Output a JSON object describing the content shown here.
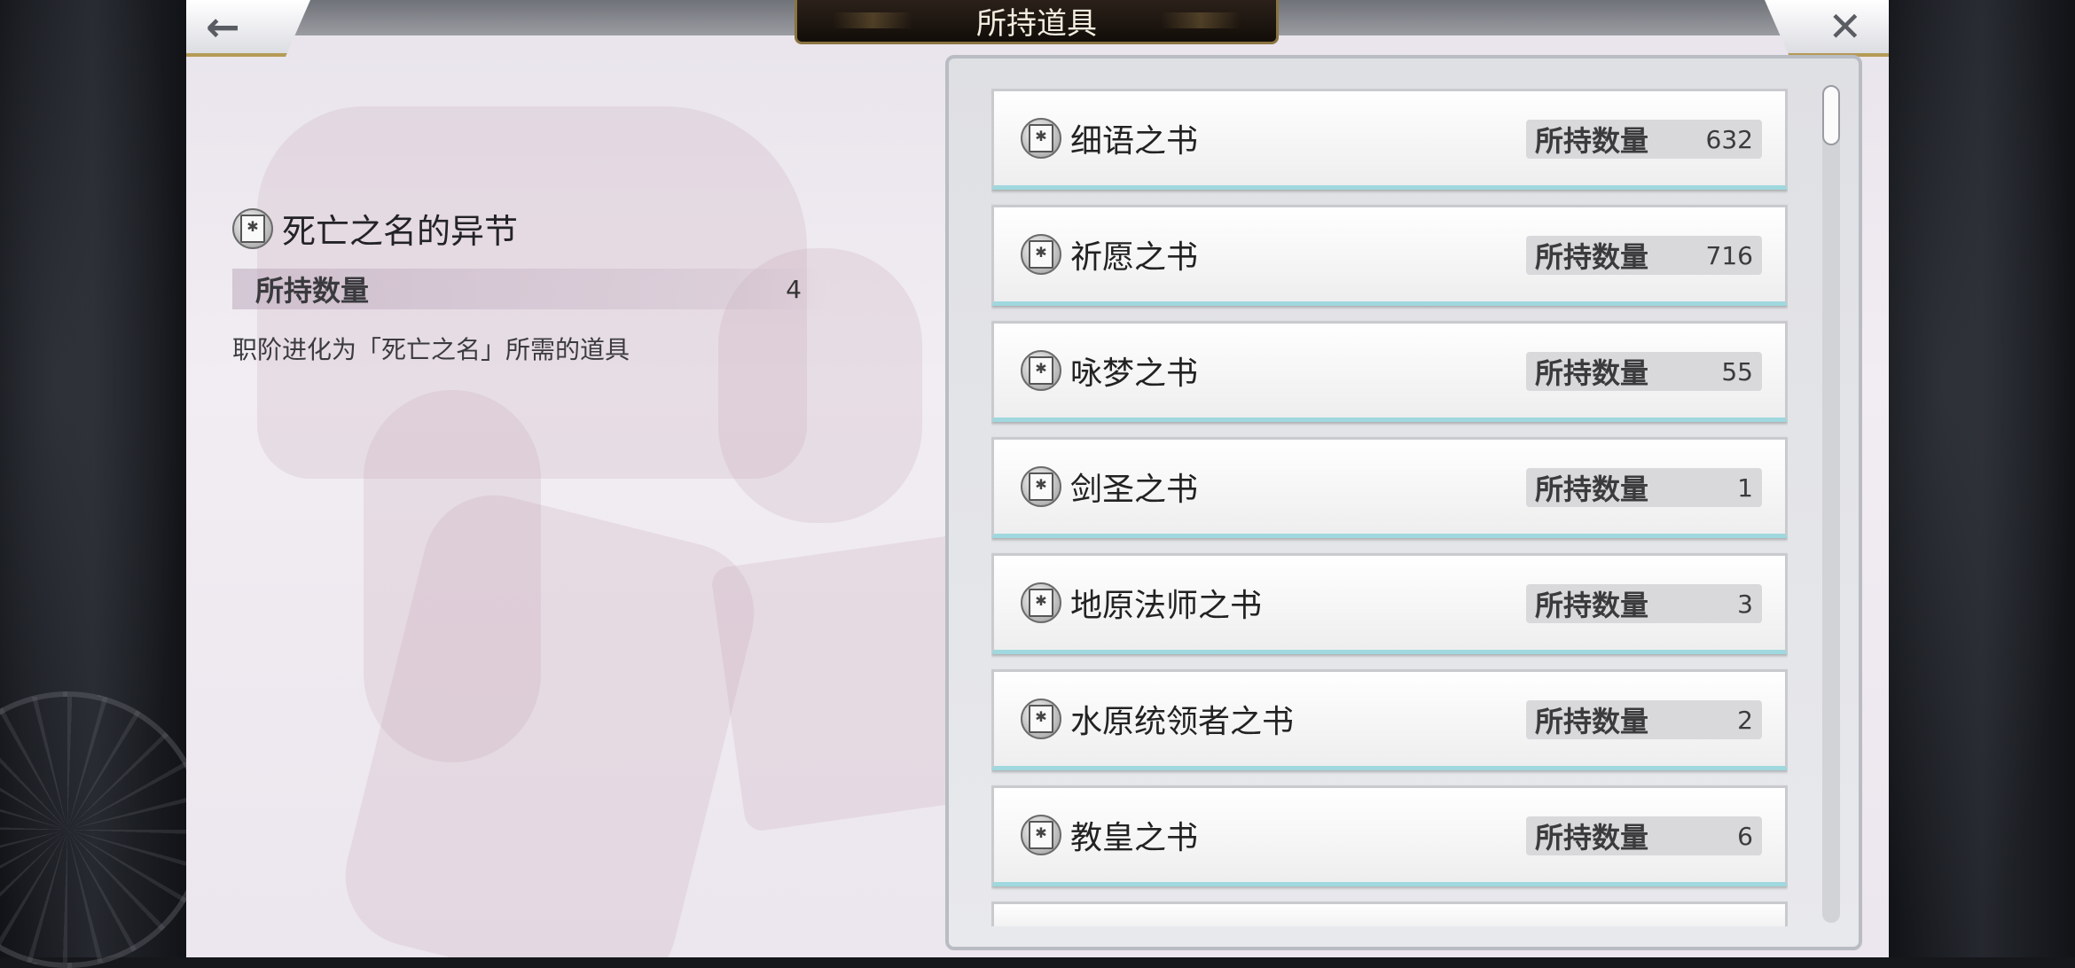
{
  "window": {
    "title": "所持道具"
  },
  "nav": {
    "back_symbol": "←",
    "close_symbol": "✕"
  },
  "detail": {
    "icon": "book-icon",
    "name": "死亡之名的异节",
    "qty_label": "所持数量",
    "qty_value": "4",
    "description": "职阶进化为「死亡之名」所需的道具"
  },
  "items": [
    {
      "name": "细语之书",
      "qty_label": "所持数量",
      "qty_value": "632"
    },
    {
      "name": "祈愿之书",
      "qty_label": "所持数量",
      "qty_value": "716"
    },
    {
      "name": "咏梦之书",
      "qty_label": "所持数量",
      "qty_value": "55"
    },
    {
      "name": "剑圣之书",
      "qty_label": "所持数量",
      "qty_value": "1"
    },
    {
      "name": "地原法师之书",
      "qty_label": "所持数量",
      "qty_value": "3"
    },
    {
      "name": "水原统领者之书",
      "qty_label": "所持数量",
      "qty_value": "2"
    },
    {
      "name": "教皇之书",
      "qty_label": "所持数量",
      "qty_value": "6"
    }
  ],
  "colors": {
    "accent_gold": "#b59a55",
    "item_bottom_border": "#9fd8de",
    "title_bg": "#120d09"
  }
}
